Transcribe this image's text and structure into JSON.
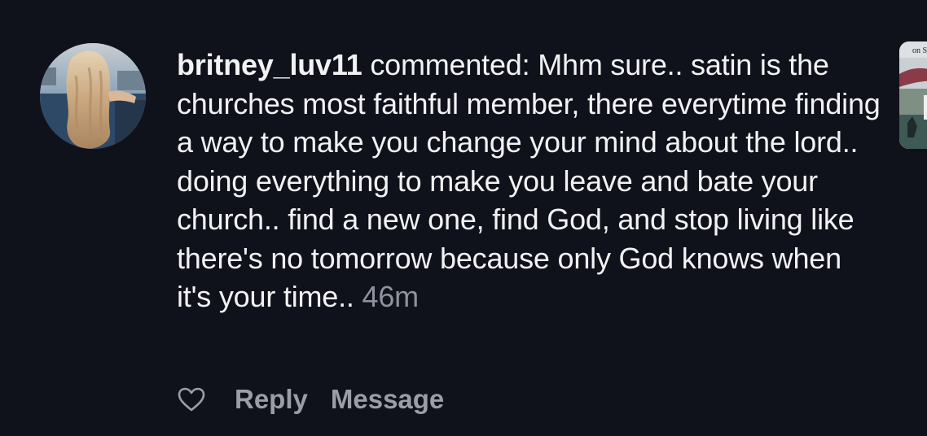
{
  "comment": {
    "username": "britney_luv11",
    "action": " commented: ",
    "text": "Mhm sure.. satin is the churches most faithful member, there everytime finding a way to make you change your mind about the lord.. doing everything to make you leave and bate your church.. find a new one, find God, and stop living like there's no tomorrow because only God knows when it's your time.. ",
    "timestamp": "46m"
  },
  "thumbnail": {
    "caption": "on S"
  },
  "actions": {
    "like_icon": "heart-outline-icon",
    "reply_label": "Reply",
    "message_label": "Message"
  },
  "colors": {
    "background": "#10121b",
    "text": "#f2f2f4",
    "muted": "#8e929c",
    "action": "#9a9ea8"
  }
}
